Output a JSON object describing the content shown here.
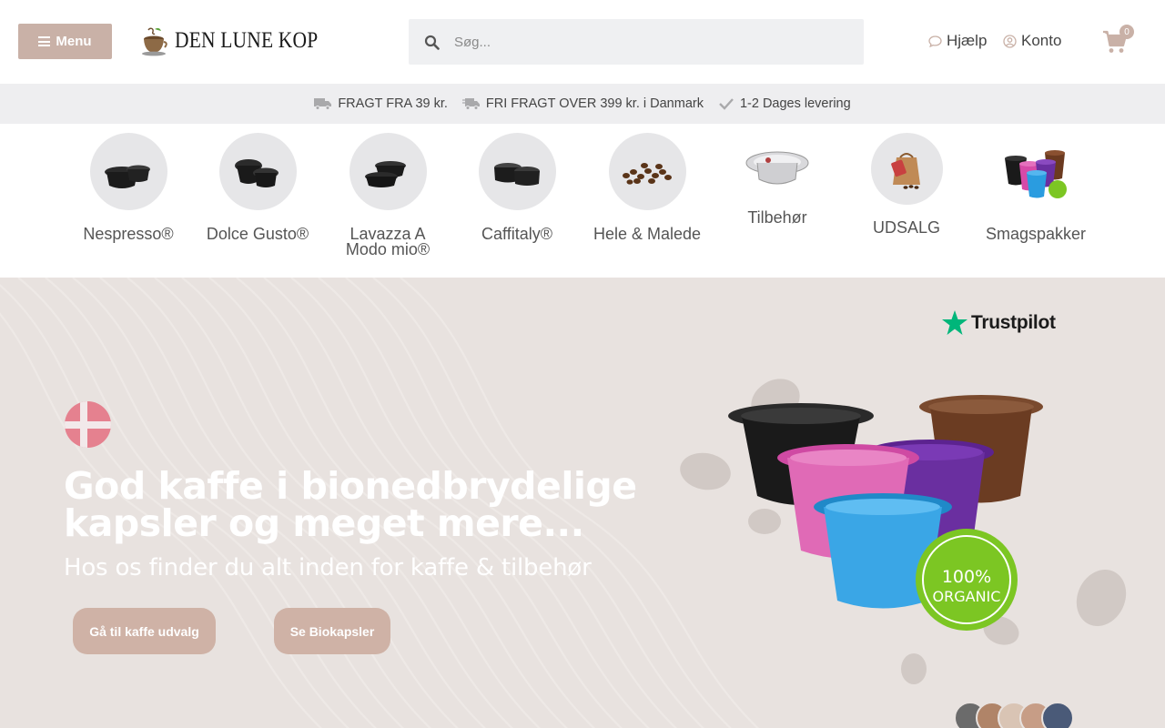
{
  "header": {
    "menu_label": "Menu",
    "logo_text": "DEN LUNE KOP",
    "search_placeholder": "Søg...",
    "help_label": "Hjælp",
    "account_label": "Konto",
    "cart_count": "0"
  },
  "usp": [
    {
      "icon": "truck-icon",
      "text": "FRAGT FRA 39 kr."
    },
    {
      "icon": "shipping-fast-icon",
      "text": "FRI FRAGT OVER 399 kr. i Danmark"
    },
    {
      "icon": "check-icon",
      "text": "1-2 Dages levering"
    }
  ],
  "categories": [
    {
      "label": "Nespresso®"
    },
    {
      "label": "Dolce Gusto®"
    },
    {
      "label": "Lavazza A Modo mio®"
    },
    {
      "label": "Caffitaly®"
    },
    {
      "label": "Hele & Malede"
    },
    {
      "label": "Tilbehør"
    },
    {
      "label": "UDSALG"
    },
    {
      "label": "Smagspakker"
    }
  ],
  "hero": {
    "headline": "God kaffe i bionedbrydelige kapsler og meget mere...",
    "subline": "Hos os finder du alt inden for kaffe & tilbehør",
    "button1": "Gå til kaffe udvalg",
    "button2": "Se Biokapsler",
    "trustpilot": "Trustpilot",
    "badge_line1": "100%",
    "badge_line2": "ORGANIC"
  },
  "colors": {
    "accent": "#c9b1a7",
    "hero_bg": "#e8e2df",
    "usp_bg": "#eeeef0",
    "flag_red": "#e5818f",
    "trustpilot_green": "#00b67a",
    "organic_green": "#7cc623"
  }
}
